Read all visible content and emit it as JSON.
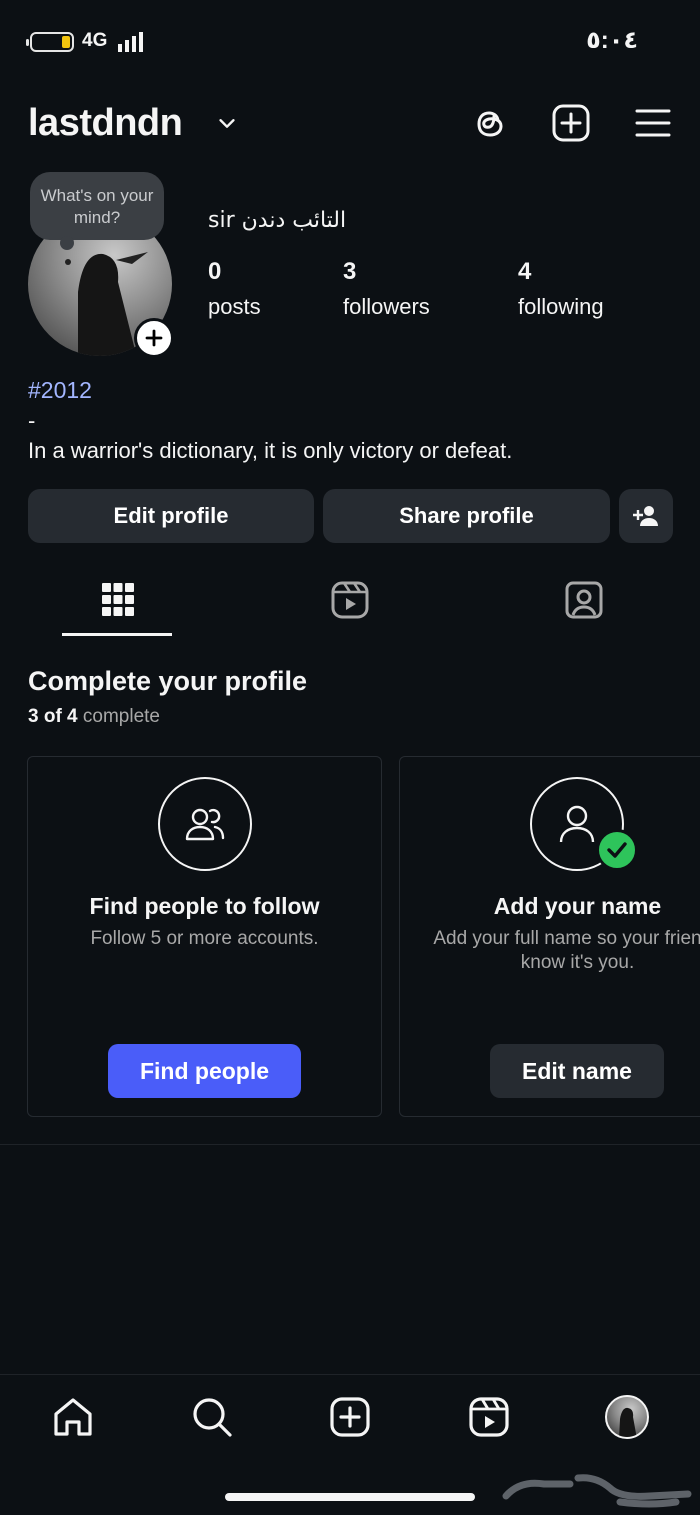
{
  "status_bar": {
    "network": "4G",
    "time": "٥:٠٤"
  },
  "header": {
    "username": "lastdndn"
  },
  "profile": {
    "note_bubble": "What's on your mind?",
    "full_name": "sir التائب دندن",
    "stats": [
      {
        "value": "0",
        "label": "posts"
      },
      {
        "value": "3",
        "label": "followers"
      },
      {
        "value": "4",
        "label": "following"
      }
    ],
    "hashtag": "#2012",
    "bio_line1": "-",
    "bio_line2": "In a warrior's dictionary, it is only victory or defeat."
  },
  "actions": {
    "edit": "Edit profile",
    "share": "Share profile"
  },
  "tabs": [
    "grid-tab",
    "reels-tab",
    "tagged-tab"
  ],
  "complete": {
    "title": "Complete your profile",
    "progress_bold": "3 of 4",
    "progress_rest": " complete",
    "cards": [
      {
        "title": "Find people to follow",
        "desc": "Follow 5 or more accounts.",
        "button": "Find people"
      },
      {
        "title": "Add your name",
        "desc": "Add your full name so your friends know it's you.",
        "button": "Edit name"
      }
    ]
  },
  "colors": {
    "background": "#0c1014",
    "button": "#262b31",
    "primary": "#4a5df9",
    "link": "#a3b6ff",
    "success": "#2ec45b"
  }
}
